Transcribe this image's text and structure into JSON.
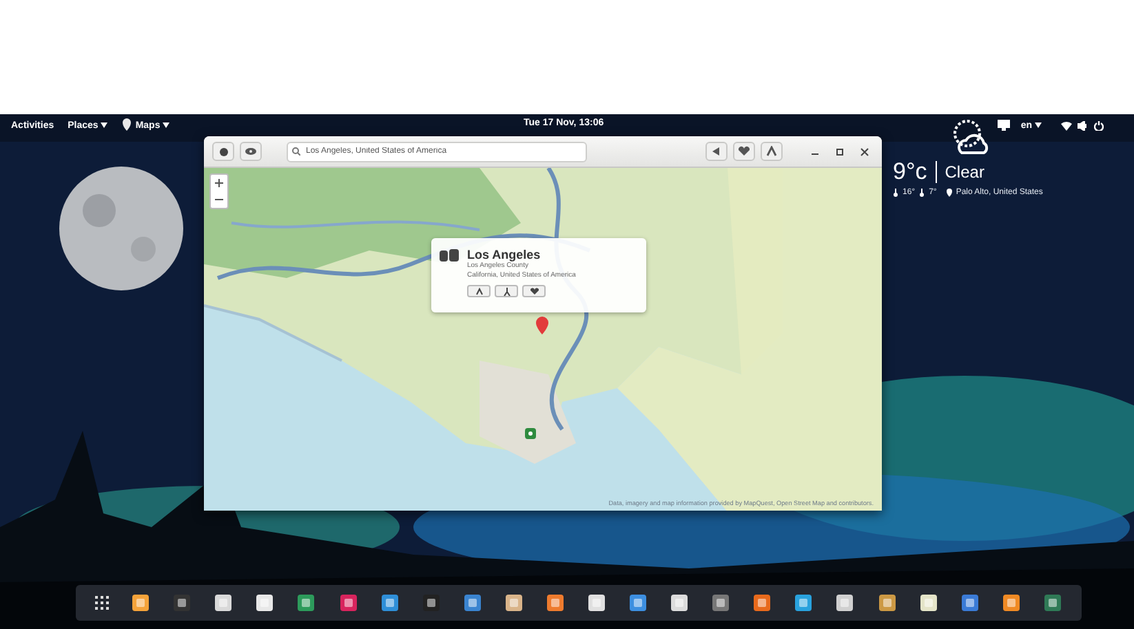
{
  "top_bar": {
    "activities": "Activities",
    "places": "Places",
    "app_menu": "Maps",
    "clock": "Tue 17 Nov, 13:06",
    "keyboard": "en"
  },
  "maps_window": {
    "search": {
      "value": "Los Angeles, United States of America"
    },
    "place_popup": {
      "title": "Los Angeles",
      "county": "Los Angeles County",
      "region": "California, United States of America"
    },
    "attribution": "Data, imagery and map information provided by MapQuest, Open Street Map and contributors."
  },
  "weather": {
    "temperature": "9°c",
    "condition": "Clear",
    "high": "16°",
    "low": "7°",
    "location": "Palo Alto, United States"
  }
}
